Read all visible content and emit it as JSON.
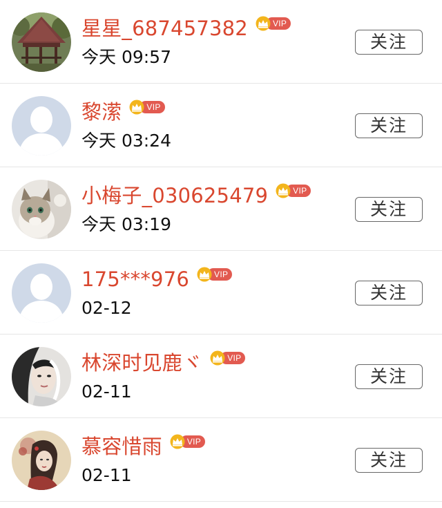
{
  "follow_label": "关注",
  "vip_label": "VIP",
  "colors": {
    "name": "#d9472f",
    "vip_badge": "#e25a50",
    "crown": "#f3b51c",
    "time": "#111111",
    "divider": "#e6e6e6"
  },
  "users": [
    {
      "name": "星星_687457382",
      "time": "今天 09:57",
      "avatar": "pavilion-photo",
      "vip": true
    },
    {
      "name": "黎潆",
      "time": "今天 03:24",
      "avatar": "default-avatar",
      "vip": true
    },
    {
      "name": "小梅子_030625479",
      "time": "今天 03:19",
      "avatar": "kitten-photo",
      "vip": true
    },
    {
      "name": "175***976",
      "time": "02-12",
      "avatar": "default-avatar",
      "vip": true
    },
    {
      "name": "林深时见鹿ヾ",
      "time": "02-11",
      "avatar": "portrait-photo",
      "vip": true
    },
    {
      "name": "慕容惜雨",
      "time": "02-11",
      "avatar": "illustration-photo",
      "vip": true
    }
  ]
}
